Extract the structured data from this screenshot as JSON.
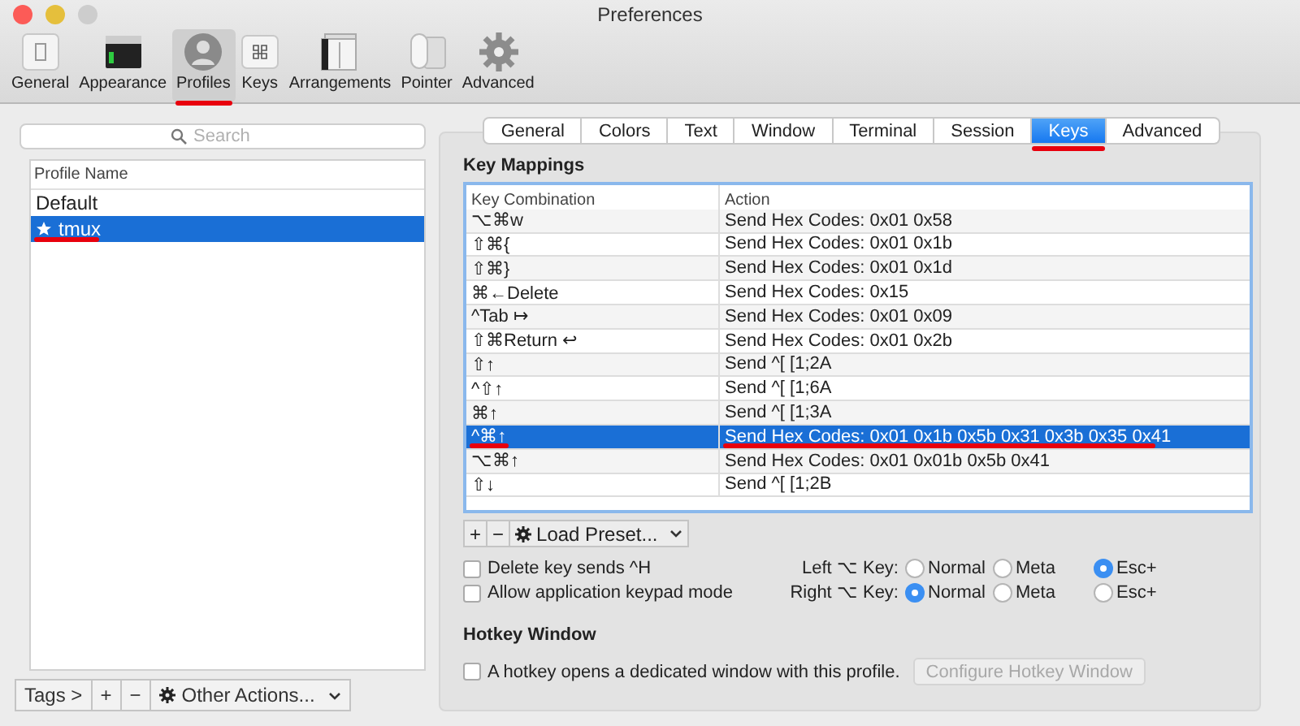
{
  "window": {
    "title": "Preferences"
  },
  "toolbar": [
    {
      "label": "General",
      "selected": false,
      "underlined": false
    },
    {
      "label": "Appearance",
      "selected": false,
      "underlined": false
    },
    {
      "label": "Profiles",
      "selected": true,
      "underlined": true
    },
    {
      "label": "Keys",
      "selected": false,
      "underlined": false
    },
    {
      "label": "Arrangements",
      "selected": false,
      "underlined": false
    },
    {
      "label": "Pointer",
      "selected": false,
      "underlined": false
    },
    {
      "label": "Advanced",
      "selected": false,
      "underlined": false
    }
  ],
  "profiles": {
    "search": {
      "placeholder": "Search"
    },
    "column": "Profile Name",
    "items": [
      {
        "name": "Default",
        "starred": false,
        "selected": false,
        "underlined": false
      },
      {
        "name": "tmux",
        "starred": true,
        "selected": true,
        "underlined": true
      }
    ],
    "bottom_bar": {
      "tags": "Tags >",
      "add": "+",
      "remove": "−",
      "actions": "Other Actions..."
    }
  },
  "tabs": [
    {
      "label": "General",
      "selected": false,
      "underlined": false
    },
    {
      "label": "Colors",
      "selected": false,
      "underlined": false
    },
    {
      "label": "Text",
      "selected": false,
      "underlined": false
    },
    {
      "label": "Window",
      "selected": false,
      "underlined": false
    },
    {
      "label": "Terminal",
      "selected": false,
      "underlined": false
    },
    {
      "label": "Session",
      "selected": false,
      "underlined": false
    },
    {
      "label": "Keys",
      "selected": true,
      "underlined": true
    },
    {
      "label": "Advanced",
      "selected": false,
      "underlined": false
    }
  ],
  "key_mappings": {
    "title": "Key Mappings",
    "columns": [
      "Key Combination",
      "Action"
    ],
    "rows": [
      {
        "key": "⌥⌘w",
        "action": "Send Hex Codes: 0x01 0x58",
        "selected": false,
        "underlined": false
      },
      {
        "key": "⇧⌘{",
        "action": "Send Hex Codes: 0x01 0x1b",
        "selected": false,
        "underlined": false
      },
      {
        "key": "⇧⌘}",
        "action": "Send Hex Codes: 0x01 0x1d",
        "selected": false,
        "underlined": false
      },
      {
        "key": "⌘←Delete",
        "action": "Send Hex Codes: 0x15",
        "selected": false,
        "underlined": false
      },
      {
        "key": "^Tab ↦",
        "action": "Send Hex Codes: 0x01 0x09",
        "selected": false,
        "underlined": false
      },
      {
        "key": "⇧⌘Return ↩",
        "action": "Send Hex Codes: 0x01 0x2b",
        "selected": false,
        "underlined": false
      },
      {
        "key": "⇧↑",
        "action": "Send ^[ [1;2A",
        "selected": false,
        "underlined": false
      },
      {
        "key": "^⇧↑",
        "action": "Send ^[ [1;6A",
        "selected": false,
        "underlined": false
      },
      {
        "key": "⌘↑",
        "action": "Send ^[ [1;3A",
        "selected": false,
        "underlined": false
      },
      {
        "key": "^⌘↑",
        "action": "Send Hex Codes: 0x01 0x1b 0x5b 0x31 0x3b 0x35 0x41",
        "selected": true,
        "underlined": true
      },
      {
        "key": "⌥⌘↑",
        "action": "Send Hex Codes: 0x01 0x01b 0x5b 0x41",
        "selected": false,
        "underlined": false
      },
      {
        "key": "⇧↓",
        "action": "Send ^[ [1;2B",
        "selected": false,
        "underlined": false
      }
    ],
    "add": "+",
    "remove": "−",
    "preset": "Load Preset..."
  },
  "checkboxes": [
    {
      "label": "Delete key sends ^H",
      "checked": false
    },
    {
      "label": "Allow application keypad mode",
      "checked": false
    }
  ],
  "option_keys": [
    {
      "label": "Left ⌥ Key:",
      "options": [
        {
          "label": "Normal",
          "selected": false
        },
        {
          "label": "Meta",
          "selected": false
        },
        {
          "label": "Esc+",
          "selected": true
        }
      ]
    },
    {
      "label": "Right ⌥ Key:",
      "options": [
        {
          "label": "Normal",
          "selected": true
        },
        {
          "label": "Meta",
          "selected": false
        },
        {
          "label": "Esc+",
          "selected": false
        }
      ]
    }
  ],
  "hotkey": {
    "title": "Hotkey Window",
    "checkbox": {
      "label": "A hotkey opens a dedicated window with this profile.",
      "checked": false
    },
    "button": "Configure Hotkey Window",
    "button_disabled": true
  }
}
